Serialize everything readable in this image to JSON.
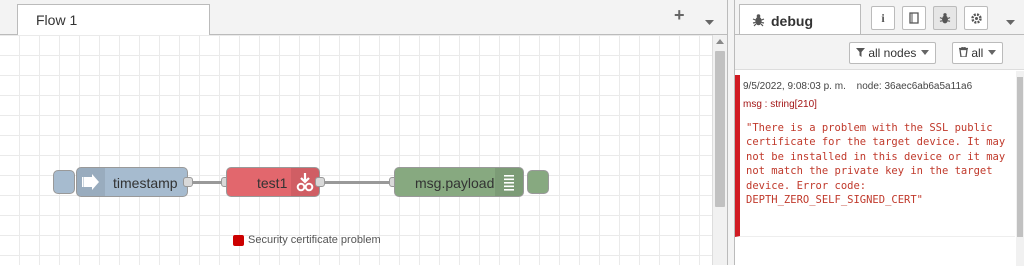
{
  "workspace": {
    "tabs": [
      {
        "label": "Flow 1"
      }
    ],
    "add_tab_icon": "plus-icon",
    "tab_menu_icon": "chevron-down-icon"
  },
  "flow": {
    "nodes": [
      {
        "id": "timestamp",
        "label": "timestamp",
        "type": "inject",
        "color": "#a6bbcf",
        "icon": "inject-arrow-icon"
      },
      {
        "id": "test1",
        "label": "test1",
        "type": "tls-check",
        "color": "#e2676d",
        "icon": "download-link-icon"
      },
      {
        "id": "debug",
        "label": "msg.payload",
        "type": "debug",
        "color": "#87a980",
        "icon": "list-lines-icon"
      }
    ],
    "status": {
      "text": "Security certificate problem",
      "color": "#c00000"
    }
  },
  "sidebar": {
    "active_tab": "debug",
    "buttons": [
      "info-icon",
      "book-icon",
      "bug-icon",
      "gear-icon",
      "chevron-down-icon"
    ],
    "filter_nodes_label": "all nodes",
    "clear_label": "all",
    "message": {
      "timestamp": "9/5/2022, 9:08:03 p. m.",
      "node": "node: 36aec6ab6a5a11a6",
      "type": "msg : string[210]",
      "payload": "\"There is a problem with the SSL public certificate for the target device. It may not be installed in this device or it may not match the private key in the target device. Error code: DEPTH_ZERO_SELF_SIGNED_CERT\""
    }
  },
  "colors": {
    "error_accent": "#d01b23",
    "grid": "#eaeaea"
  }
}
